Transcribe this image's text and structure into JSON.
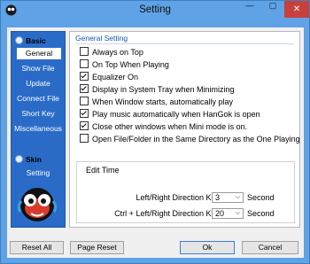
{
  "window": {
    "title": "Setting",
    "minimize_glyph": "—",
    "maximize_glyph": "▢",
    "close_glyph": "✕",
    "close_color": "#c9403a"
  },
  "sidebar": {
    "basic_heading": "Basic",
    "skin_heading": "Skin",
    "items": [
      {
        "label": "General",
        "selected": true
      },
      {
        "label": "Show File",
        "selected": false
      },
      {
        "label": "Update",
        "selected": false
      },
      {
        "label": "Connect File",
        "selected": false
      },
      {
        "label": "Short Key",
        "selected": false
      },
      {
        "label": "Miscellaneous",
        "selected": false
      }
    ],
    "skin_items": [
      {
        "label": "Setting",
        "selected": false
      }
    ]
  },
  "general": {
    "section_title": "General Setting",
    "options": [
      {
        "label": "Always on Top",
        "checked": false
      },
      {
        "label": "On Top When Playing",
        "checked": false
      },
      {
        "label": "Equalizer On",
        "checked": true
      },
      {
        "label": "Display in System Tray when Minimizing",
        "checked": true
      },
      {
        "label": "When Window starts, automatically play",
        "checked": false
      },
      {
        "label": "Play music automatically when HanGok is open",
        "checked": true
      },
      {
        "label": "Close other windows when Mini mode is on.",
        "checked": true
      },
      {
        "label": "Open File/Folder in the Same Directory as the One Playing",
        "checked": false
      }
    ],
    "edit_time": {
      "title": "Edit Time",
      "rows": [
        {
          "label": "Left/Right Direction Key",
          "value": "3",
          "unit": "Second"
        },
        {
          "label": "Ctrl + Left/Right Direction Key",
          "value": "20",
          "unit": "Second"
        }
      ]
    }
  },
  "buttons": {
    "reset_all": "Reset All",
    "page_reset": "Page Reset",
    "ok": "Ok",
    "cancel": "Cancel"
  }
}
